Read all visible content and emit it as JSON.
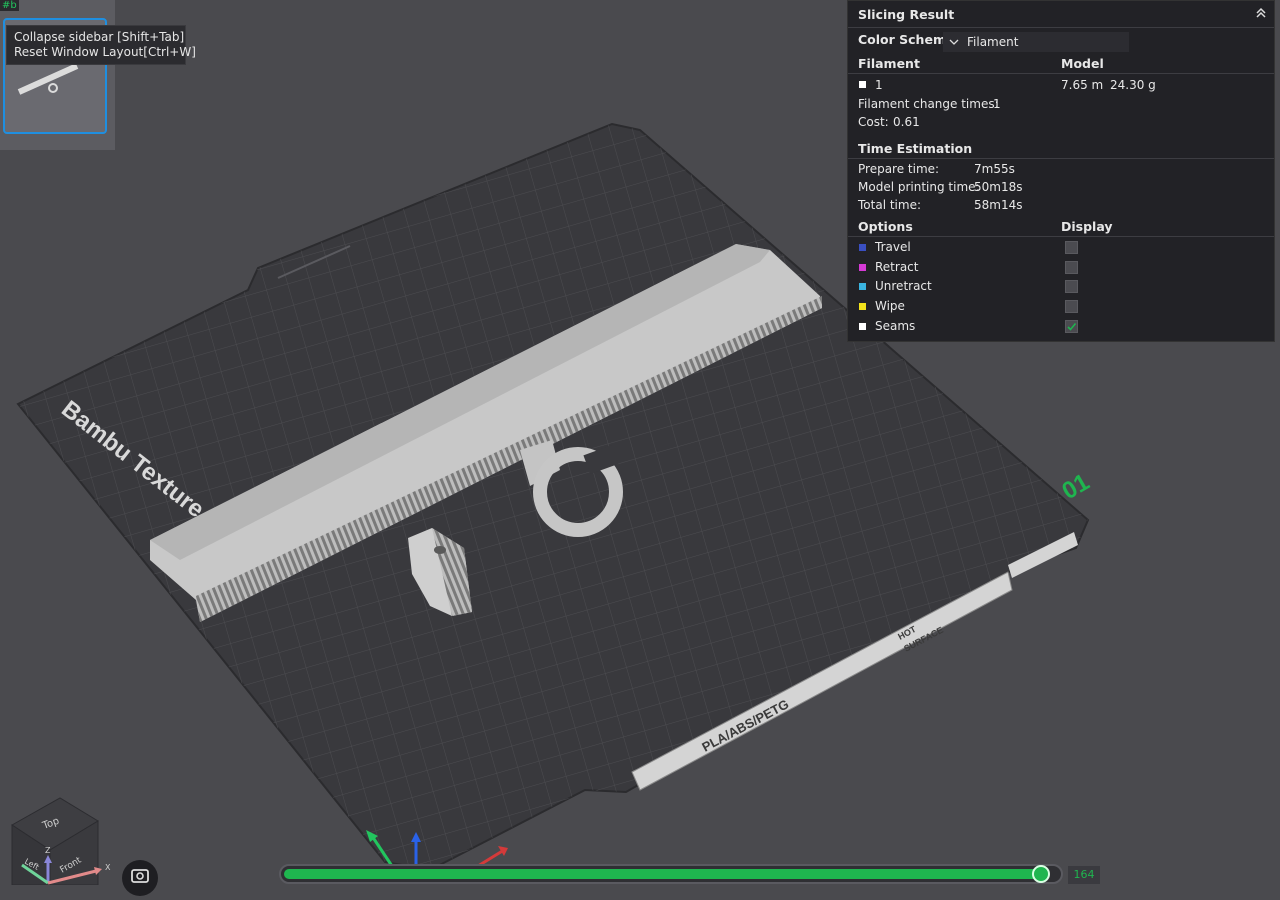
{
  "thumbnail": {
    "tag": "#b"
  },
  "tooltip": {
    "line1": "Collapse sidebar [Shift+Tab]",
    "line2": "Reset Window Layout[Ctrl+W]"
  },
  "plate": {
    "brand_text": "Bambu Texture",
    "plate_number": "01",
    "material_text": "PLA/ABS/PETG",
    "hot_text": "HOT",
    "surface_text": "SURFACE"
  },
  "slicing": {
    "title": "Slicing Result",
    "color_scheme_label": "Color Scheme",
    "color_scheme_value": "Filament",
    "filament_header": "Filament",
    "model_header": "Model",
    "filament_row": {
      "id": "1",
      "length": "7.65 m",
      "weight": "24.30 g"
    },
    "change_times_label": "Filament change times:",
    "change_times_value": "1",
    "cost_label": "Cost:",
    "cost_value": "0.61",
    "time_header": "Time Estimation",
    "prepare_label": "Prepare time:",
    "prepare_value": "7m55s",
    "model_time_label": "Model printing time:",
    "model_time_value": "50m18s",
    "total_label": "Total time:",
    "total_value": "58m14s",
    "options_header": "Options",
    "display_header": "Display",
    "options": [
      {
        "label": "Travel",
        "color": "#3a4fc1",
        "checked": false
      },
      {
        "label": "Retract",
        "color": "#d63ad6",
        "checked": false
      },
      {
        "label": "Unretract",
        "color": "#3ab4e0",
        "checked": false
      },
      {
        "label": "Wipe",
        "color": "#f2e21c",
        "checked": false
      },
      {
        "label": "Seams",
        "color": "#ffffff",
        "checked": true
      }
    ]
  },
  "navcube": {
    "top": "Top",
    "left": "Left",
    "front": "Front",
    "z": "Z",
    "x": "X"
  },
  "layer_slider": {
    "value": "164",
    "fraction": 0.99
  },
  "colors": {
    "accent": "#1fb54f",
    "panel_bg": "#222226",
    "background": "#4a4a4e"
  }
}
